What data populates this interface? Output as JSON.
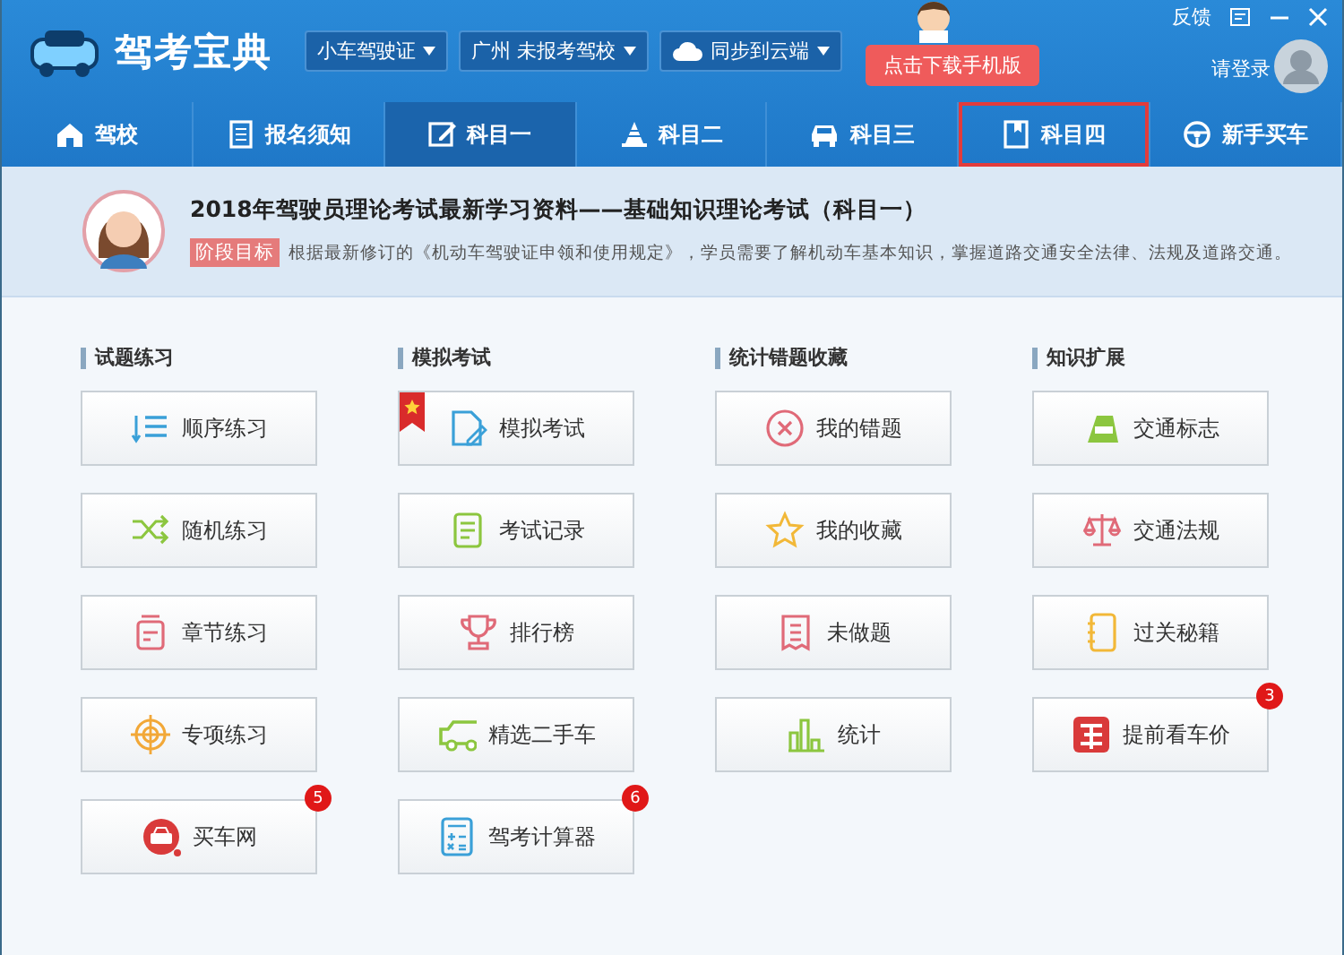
{
  "app": {
    "title": "驾考宝典"
  },
  "dropdowns": [
    {
      "label": "小车驾驶证"
    },
    {
      "label": "广州 未报考驾校"
    },
    {
      "label": "同步到云端"
    }
  ],
  "download_button": "点击下载手机版",
  "window_controls": {
    "feedback": "反馈"
  },
  "login": "请登录",
  "tabs": [
    {
      "label": "驾校",
      "selected": false,
      "highlighted": false
    },
    {
      "label": "报名须知",
      "selected": false,
      "highlighted": false
    },
    {
      "label": "科目一",
      "selected": true,
      "highlighted": false
    },
    {
      "label": "科目二",
      "selected": false,
      "highlighted": false
    },
    {
      "label": "科目三",
      "selected": false,
      "highlighted": false
    },
    {
      "label": "科目四",
      "selected": false,
      "highlighted": true
    },
    {
      "label": "新手买车",
      "selected": false,
      "highlighted": false
    }
  ],
  "banner": {
    "title": "2018年驾驶员理论考试最新学习资料——基础知识理论考试（科目一）",
    "tag": "阶段目标",
    "text": "根据最新修订的《机动车驾驶证申领和使用规定》，学员需要了解机动车基本知识，掌握道路交通安全法律、法规及道路交通。"
  },
  "sections": [
    {
      "title": "试题练习",
      "items": [
        {
          "label": "顺序练习",
          "ribbon": false
        },
        {
          "label": "随机练习",
          "ribbon": false
        },
        {
          "label": "章节练习",
          "ribbon": false
        },
        {
          "label": "专项练习",
          "ribbon": false
        },
        {
          "label": "买车网",
          "ribbon": false,
          "badge": "5"
        }
      ]
    },
    {
      "title": "模拟考试",
      "items": [
        {
          "label": "模拟考试",
          "ribbon": true
        },
        {
          "label": "考试记录",
          "ribbon": false
        },
        {
          "label": "排行榜",
          "ribbon": false
        },
        {
          "label": "精选二手车",
          "ribbon": false
        },
        {
          "label": "驾考计算器",
          "ribbon": false,
          "badge": "6"
        }
      ]
    },
    {
      "title": "统计错题收藏",
      "items": [
        {
          "label": "我的错题",
          "ribbon": false
        },
        {
          "label": "我的收藏",
          "ribbon": false
        },
        {
          "label": "未做题",
          "ribbon": false
        },
        {
          "label": "统计",
          "ribbon": false
        }
      ]
    },
    {
      "title": "知识扩展",
      "items": [
        {
          "label": "交通标志",
          "ribbon": false
        },
        {
          "label": "交通法规",
          "ribbon": false
        },
        {
          "label": "过关秘籍",
          "ribbon": false
        },
        {
          "label": "提前看车价",
          "ribbon": false,
          "badge": "3"
        }
      ]
    }
  ]
}
